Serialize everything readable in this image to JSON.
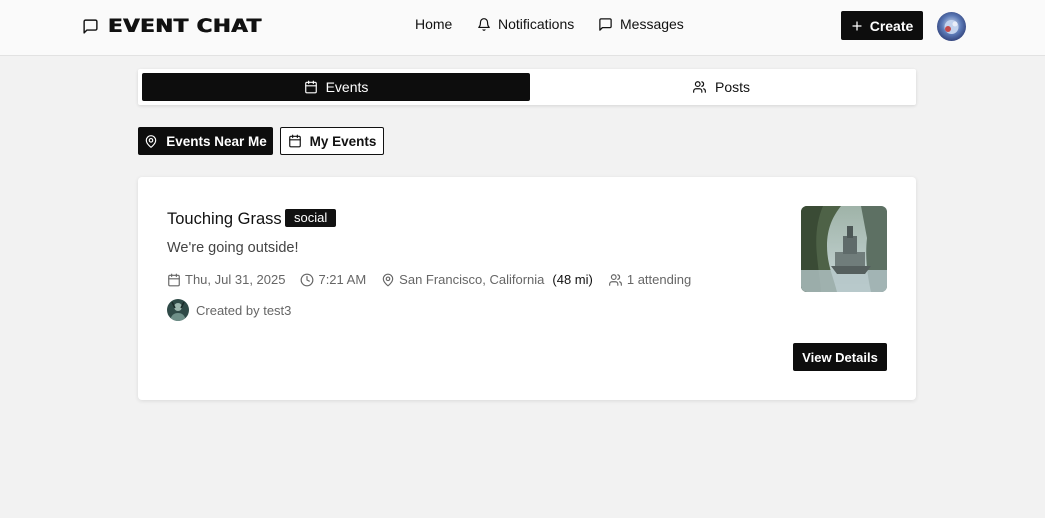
{
  "header": {
    "brand": "EVENT CHAT",
    "brand_icon": "message-square-icon",
    "nav": {
      "home": "Home",
      "notifications": "Notifications",
      "messages": "Messages"
    },
    "create_label": "Create"
  },
  "tabs": {
    "events": "Events",
    "posts": "Posts",
    "active": "Events"
  },
  "filters": {
    "near_me": "Events Near Me",
    "my_events": "My Events",
    "active": "Events Near Me"
  },
  "event": {
    "title": "Touching Grass",
    "tag": "social",
    "description": "We're going outside!",
    "date": "Thu, Jul 31, 2025",
    "time": "7:21 AM",
    "location": "San Francisco, California",
    "distance": "(48 mi)",
    "attending": "1 attending",
    "creator": "Created by test3",
    "details_label": "View Details"
  },
  "colors": {
    "accent": "#0d0d0d",
    "background": "#f2f2f2",
    "card": "#ffffff"
  }
}
